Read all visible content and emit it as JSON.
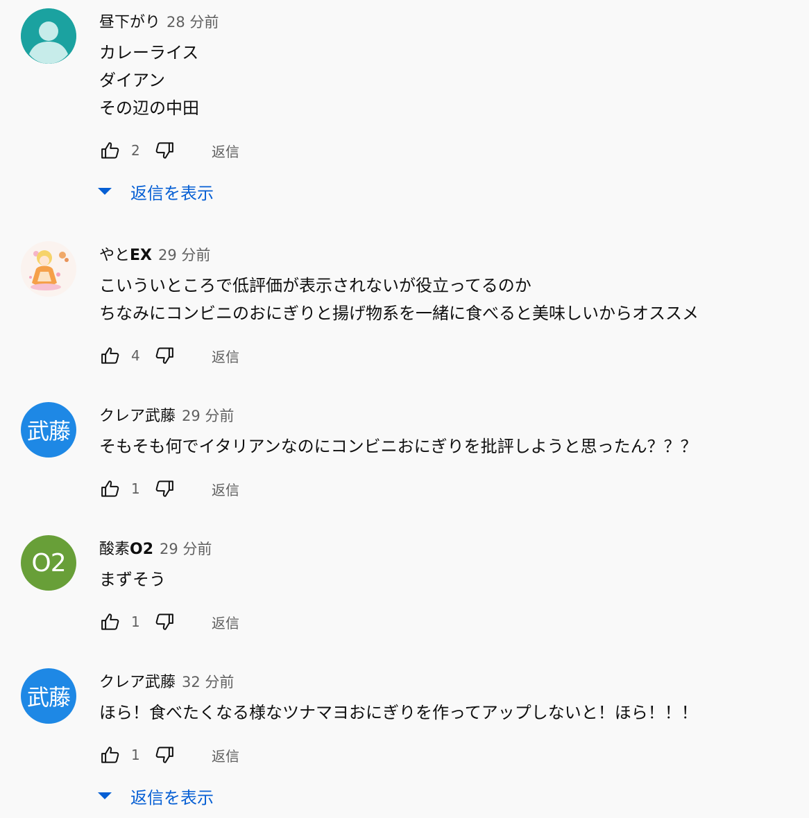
{
  "comments": [
    {
      "author": "昼下がり",
      "time": "28 分前",
      "lines": [
        "カレーライス",
        "ダイアン",
        "その辺の中田"
      ],
      "likes": "2",
      "reply_label": "返信",
      "show_replies": "返信を表示",
      "avatar": {
        "type": "default",
        "color": "#26a69a"
      }
    },
    {
      "author_prefix": "やと",
      "author_bold": "EX",
      "time": "29 分前",
      "lines": [
        "こいういところで低評価が表示されないが役立ってるのか",
        "ちなみにコンビニのおにぎりと揚げ物系を一緒に食べると美味しいからオススメ"
      ],
      "likes": "4",
      "reply_label": "返信",
      "avatar": {
        "type": "image"
      }
    },
    {
      "author": "クレア武藤",
      "time": "29 分前",
      "lines": [
        "そもそも何でイタリアンなのにコンビニおにぎりを批評しようと思ったん？？？"
      ],
      "likes": "1",
      "reply_label": "返信",
      "avatar": {
        "type": "initials",
        "text": "武藤",
        "color": "#1e88e5"
      }
    },
    {
      "author_prefix": "酸素",
      "author_bold": "O2",
      "time": "29 分前",
      "lines": [
        "まずそう"
      ],
      "likes": "1",
      "reply_label": "返信",
      "avatar": {
        "type": "initials",
        "text": "O2",
        "color": "#689f38"
      }
    },
    {
      "author": "クレア武藤",
      "time": "32 分前",
      "lines": [
        "ほら！食べたくなる様なツナマヨおにぎりを作ってアップしないと！ほら！！！"
      ],
      "likes": "1",
      "reply_label": "返信",
      "show_replies": "返信を表示",
      "avatar": {
        "type": "initials",
        "text": "武藤",
        "color": "#1e88e5"
      }
    }
  ],
  "icons": {
    "like": "thumb-up-icon",
    "dislike": "thumb-down-icon",
    "expand": "caret-down-icon"
  }
}
